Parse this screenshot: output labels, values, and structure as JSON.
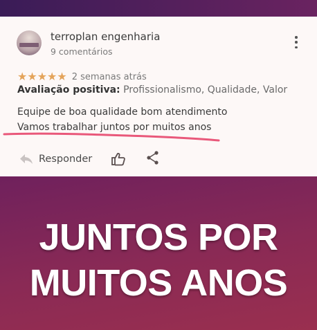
{
  "review": {
    "author": "terroplan engenharia",
    "comments": "9 comentários",
    "stars": "★★★★★",
    "date": "2 semanas atrás",
    "evaluation_label": "Avaliação positiva:",
    "evaluation_values": " Profissionalismo, Qualidade, Valor",
    "text_line1": "Equipe de boa qualidade bom atendimento",
    "text_line2": "Vamos trabalhar juntos por muitos anos",
    "rating_value": 5,
    "rating_max": 5
  },
  "actions": {
    "reply_label": "Responder",
    "like_icon": "thumbs-up-icon",
    "share_icon": "share-icon",
    "reply_icon": "reply-arrow-icon"
  },
  "headline": {
    "line1": "JUNTOS POR",
    "line2": "MUITOS ANOS"
  },
  "colors": {
    "star": "#e4a45b",
    "underline": "#e9587a",
    "background_top": "#5a1e63",
    "background_bottom": "#9a2f4f"
  }
}
